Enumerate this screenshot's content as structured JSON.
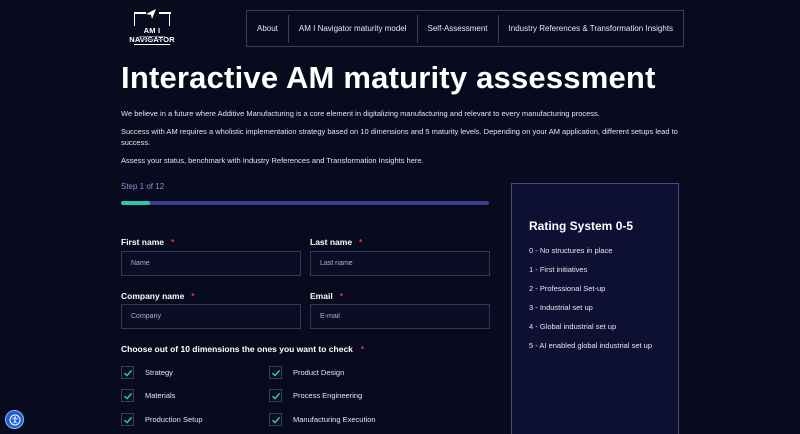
{
  "header": {
    "logo_text": "AM I NAVIGATOR",
    "nav": [
      "About",
      "AM I Navigator maturity model",
      "Self-Assessment",
      "Industry References & Transformation Insights"
    ]
  },
  "page_title": "Interactive AM maturity assessment",
  "intro": [
    "We believe in a future where Additive Manufacturing is a core element in digitalizing manufacturing and relevant to every manufacturing process.",
    "Success with AM requires a wholistic implementation strategy based on 10 dimensions and 5 maturity levels. Depending on your AM application, different setups lead to success.",
    "Assess your status, benchmark with Industry References and Transformation Insights here."
  ],
  "form": {
    "step_label": "Step 1 of 12",
    "progress": 0.08,
    "required_mark": "*",
    "fields": {
      "first_name": {
        "label": "First name",
        "placeholder": "Name",
        "value": ""
      },
      "last_name": {
        "label": "Last name",
        "placeholder": "Last name",
        "value": ""
      },
      "company": {
        "label": "Company name",
        "placeholder": "Company",
        "value": ""
      },
      "email": {
        "label": "Email",
        "placeholder": "E-mail",
        "value": ""
      }
    },
    "dimensions_title": "Choose out of 10 dimensions the ones you want to check",
    "dimensions": [
      {
        "label": "Strategy",
        "checked": true
      },
      {
        "label": "Product Design",
        "checked": true
      },
      {
        "label": "Materials",
        "checked": true
      },
      {
        "label": "Process Engineering",
        "checked": true
      },
      {
        "label": "Production Setup",
        "checked": true
      },
      {
        "label": "Manufacturing Execution",
        "checked": true
      }
    ]
  },
  "rating": {
    "title": "Rating System 0-5",
    "items": [
      "0 - No structures in place",
      "1 - First initiatives",
      "2 - Professional Set-up",
      "3 - Industrial set up",
      "4 - Global industrial set up",
      "5 - AI enabled global industrial set up"
    ]
  },
  "colors": {
    "background": "#080a1e",
    "accent": "#2fc4b0",
    "progress_track": "#3b3e8a",
    "required": "#e03a3a",
    "check": "#2fc4b0",
    "panel": "#0e1033"
  },
  "icons": {
    "accessibility": "accessibility-icon",
    "check": "check-icon",
    "logo_arrow": "paper-plane-icon"
  }
}
